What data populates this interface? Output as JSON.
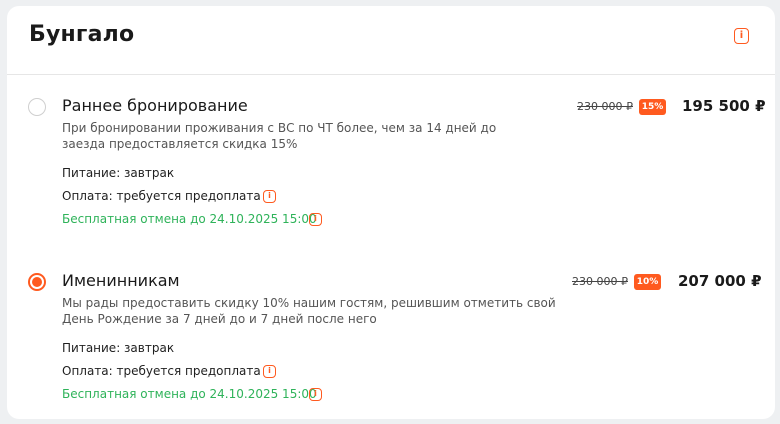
{
  "page": {
    "title": "Бунгало"
  },
  "offers": [
    {
      "title": "Раннее бронирование",
      "selected": false,
      "description": "При бронировании проживания с ВС по ЧТ более, чем за 14 дней до заезда предоставляется скидка 15%",
      "meal": "Питание: завтрак",
      "payment": "Оплата: требуется предоплата",
      "cancellation": "Бесплатная отмена до 24.10.2025 15:00",
      "old_price": "230 000 ₽",
      "discount": "15%",
      "price": "195 500 ₽"
    },
    {
      "title": "Именинникам",
      "selected": true,
      "description": "Мы рады предоставить скидку 10% нашим гостям, решившим отметить свой День Рождение за 7 дней до и 7 дней после него",
      "meal": "Питание: завтрак",
      "payment": "Оплата: требуется предоплата",
      "cancellation": "Бесплатная отмена до 24.10.2025 15:00",
      "old_price": "230 000 ₽",
      "discount": "10%",
      "price": "207 000 ₽"
    }
  ],
  "icons": {
    "info": "info-icon",
    "glyph": "i"
  },
  "colors": {
    "accent": "#ff5a1f",
    "success": "#2fb35a",
    "text": "#1f1f1f"
  }
}
